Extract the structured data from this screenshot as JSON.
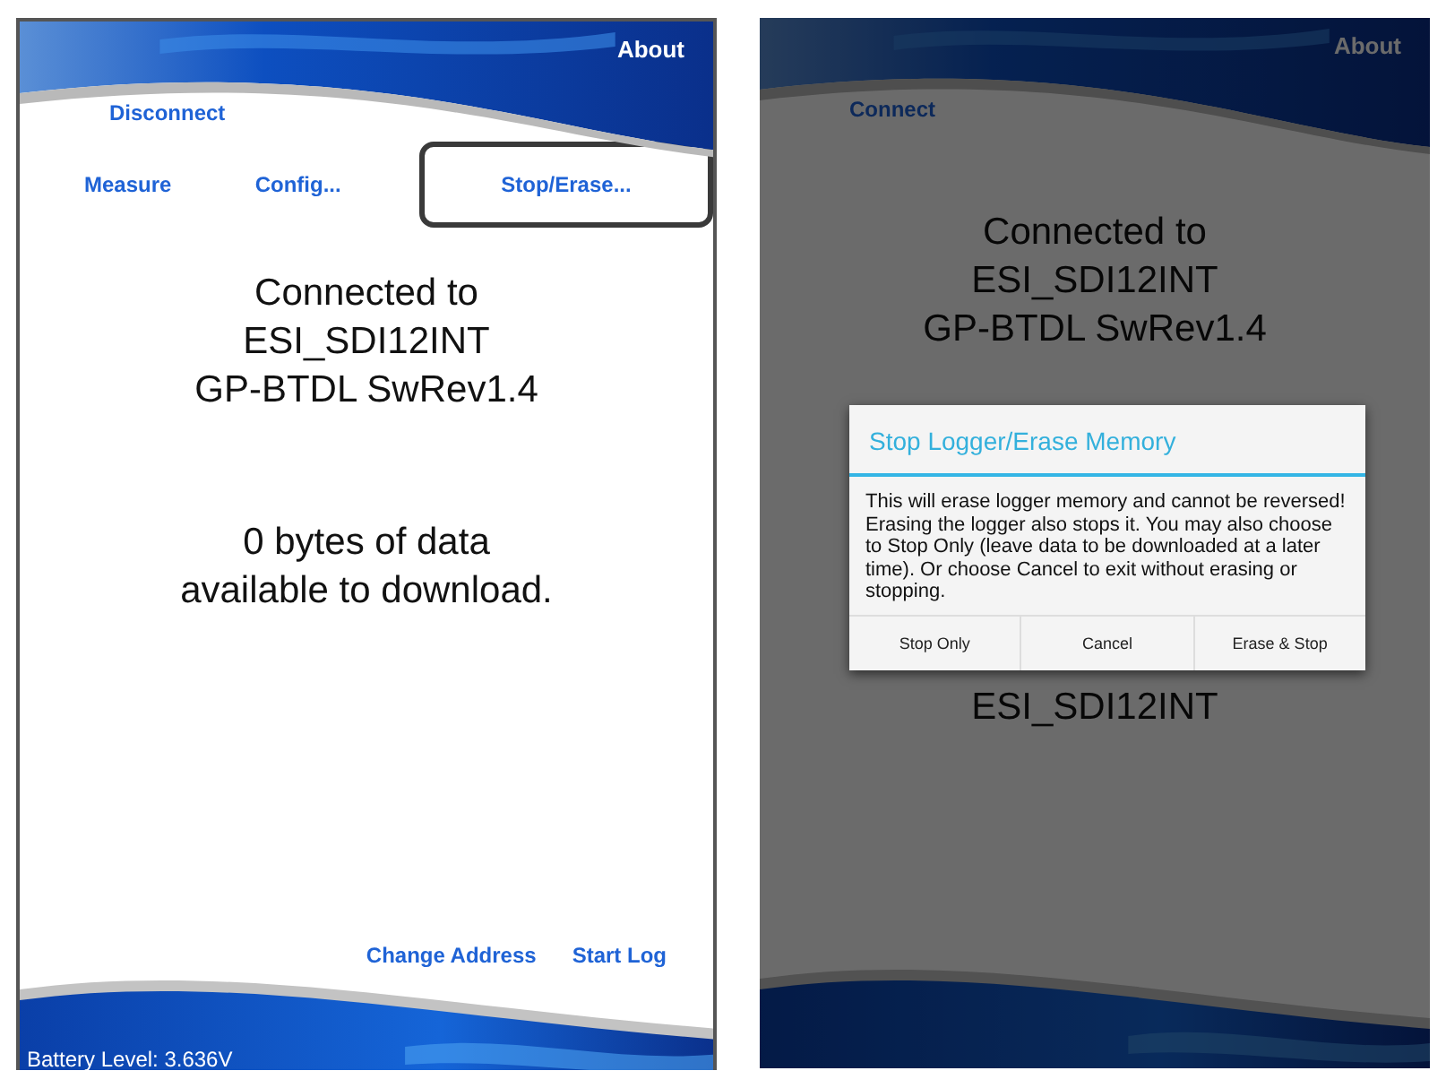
{
  "screens": [
    {
      "dimmed": false,
      "header": {
        "about": "About",
        "connection_button": "Disconnect"
      },
      "nav": [
        {
          "label": "Measure",
          "highlighted": false
        },
        {
          "label": "Config...",
          "highlighted": false
        },
        {
          "label": "Stop/Erase...",
          "highlighted": true
        }
      ],
      "status_lines": [
        "Connected to",
        "ESI_SDI12INT",
        "GP-BTDL SwRev1.4"
      ],
      "data_lines": [
        "0 bytes of data",
        "available to download."
      ],
      "bottom_actions": [
        "Change Address",
        "Start Log"
      ],
      "battery": "Battery Level: 3.636V"
    },
    {
      "dimmed": true,
      "header": {
        "about": "About",
        "connection_button": "Connect"
      },
      "status_lines": [
        "Connected to",
        "ESI_SDI12INT",
        "GP-BTDL SwRev1.4"
      ],
      "partly_covered_text": "ESI_SDI12INT",
      "dialog": {
        "title": "Stop Logger/Erase Memory",
        "message": "This will erase logger memory and cannot be reversed!\nErasing the logger also stops it. You may also choose to Stop Only (leave data to be downloaded at a later time). Or choose Cancel to exit without erasing or stopping.",
        "buttons": [
          "Stop Only",
          "Cancel",
          "Erase & Stop"
        ]
      }
    }
  ]
}
